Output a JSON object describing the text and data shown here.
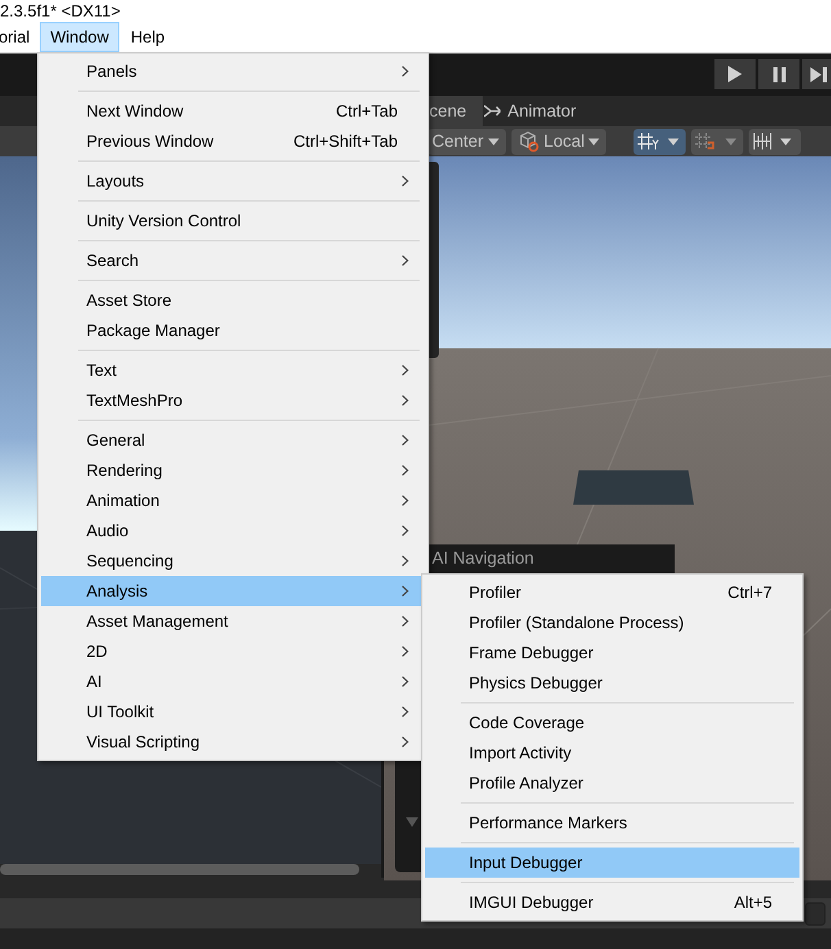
{
  "title_bar": {
    "text": "2.3.5f1* <DX11>"
  },
  "menu_bar": [
    {
      "label": "orial",
      "selected": false
    },
    {
      "label": "Window",
      "selected": true
    },
    {
      "label": "Help",
      "selected": false
    }
  ],
  "scene_tabs": [
    {
      "label": "cene",
      "selected": true,
      "kind": "scene"
    },
    {
      "label": "Animator",
      "selected": false,
      "kind": "animator"
    }
  ],
  "scene_toolbar": {
    "pivot": "Center",
    "space": "Local"
  },
  "overlay_panel": {
    "title": "AI Navigation"
  },
  "window_menu": {
    "groups": [
      [
        {
          "label": "Panels",
          "submenu": true,
          "selected": false
        }
      ],
      [
        {
          "label": "Next Window",
          "shortcut": "Ctrl+Tab",
          "submenu": false,
          "selected": false
        },
        {
          "label": "Previous Window",
          "shortcut": "Ctrl+Shift+Tab",
          "submenu": false,
          "selected": false
        }
      ],
      [
        {
          "label": "Layouts",
          "submenu": true,
          "selected": false
        }
      ],
      [
        {
          "label": "Unity Version Control",
          "submenu": false,
          "selected": false
        }
      ],
      [
        {
          "label": "Search",
          "submenu": true,
          "selected": false
        }
      ],
      [
        {
          "label": "Asset Store",
          "submenu": false,
          "selected": false
        },
        {
          "label": "Package Manager",
          "submenu": false,
          "selected": false
        }
      ],
      [
        {
          "label": "Text",
          "submenu": true,
          "selected": false
        },
        {
          "label": "TextMeshPro",
          "submenu": true,
          "selected": false
        }
      ],
      [
        {
          "label": "General",
          "submenu": true,
          "selected": false
        },
        {
          "label": "Rendering",
          "submenu": true,
          "selected": false
        },
        {
          "label": "Animation",
          "submenu": true,
          "selected": false
        },
        {
          "label": "Audio",
          "submenu": true,
          "selected": false
        },
        {
          "label": "Sequencing",
          "submenu": true,
          "selected": false
        },
        {
          "label": "Analysis",
          "submenu": true,
          "selected": true
        },
        {
          "label": "Asset Management",
          "submenu": true,
          "selected": false
        },
        {
          "label": "2D",
          "submenu": true,
          "selected": false
        },
        {
          "label": "AI",
          "submenu": true,
          "selected": false
        },
        {
          "label": "UI Toolkit",
          "submenu": true,
          "selected": false
        },
        {
          "label": "Visual Scripting",
          "submenu": true,
          "selected": false
        }
      ]
    ]
  },
  "analysis_submenu": {
    "groups": [
      [
        {
          "label": "Profiler",
          "shortcut": "Ctrl+7",
          "submenu": false,
          "selected": false
        },
        {
          "label": "Profiler (Standalone Process)",
          "submenu": false,
          "selected": false
        },
        {
          "label": "Frame Debugger",
          "submenu": false,
          "selected": false
        },
        {
          "label": "Physics Debugger",
          "submenu": false,
          "selected": false
        }
      ],
      [
        {
          "label": "Code Coverage",
          "submenu": false,
          "selected": false
        },
        {
          "label": "Import Activity",
          "submenu": false,
          "selected": false
        },
        {
          "label": "Profile Analyzer",
          "submenu": false,
          "selected": false
        }
      ],
      [
        {
          "label": "Performance Markers",
          "submenu": false,
          "selected": false
        }
      ],
      [
        {
          "label": "Input Debugger",
          "submenu": false,
          "selected": true
        }
      ],
      [
        {
          "label": "IMGUI Debugger",
          "shortcut": "Alt+5",
          "submenu": false,
          "selected": false
        }
      ]
    ]
  }
}
